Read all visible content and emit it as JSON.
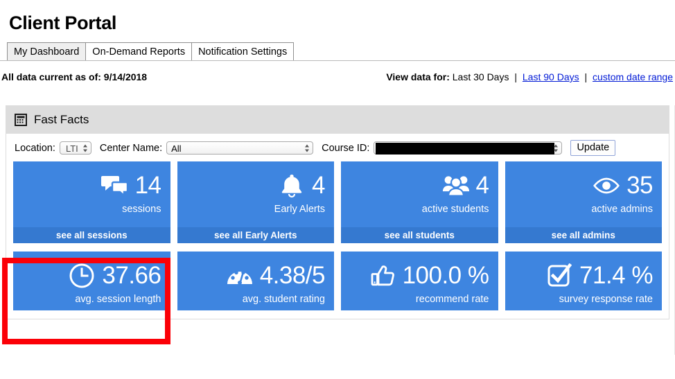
{
  "page": {
    "title": "Client Portal"
  },
  "tabs": [
    {
      "label": "My Dashboard",
      "active": true
    },
    {
      "label": "On-Demand Reports",
      "active": false
    },
    {
      "label": "Notification Settings",
      "active": false
    }
  ],
  "data_status": {
    "as_of_label": "All data current as of: 9/14/2018",
    "view_label": "View data for:",
    "current_range": "Last 30 Days",
    "separator": "|",
    "link_90": "Last 90 Days",
    "link_custom": "custom date range"
  },
  "panel": {
    "header_title": "Fast Facts",
    "header_icon": "calculator-icon",
    "filters": {
      "location_label": "Location:",
      "location_value": "LTI",
      "center_label": "Center Name:",
      "center_value": "All",
      "course_label": "Course ID:",
      "course_value": "",
      "update_label": "Update"
    }
  },
  "tiles_row1": [
    {
      "icon": "chat-bubbles-icon",
      "value": "14",
      "label": "sessions",
      "footer": "see all sessions"
    },
    {
      "icon": "bell-icon",
      "value": "4",
      "label": "Early Alerts",
      "footer": "see all Early Alerts"
    },
    {
      "icon": "people-group-icon",
      "value": "4",
      "label": "active students",
      "footer": "see all students"
    },
    {
      "icon": "eye-icon",
      "value": "35",
      "label": "active admins",
      "footer": "see all admins"
    }
  ],
  "tiles_row2": [
    {
      "icon": "clock-icon",
      "value": "37.66",
      "label": "avg. session length"
    },
    {
      "icon": "gauge-icon",
      "value": "4.38/5",
      "label": "avg. student rating"
    },
    {
      "icon": "thumbs-up-icon",
      "value": "100.0 %",
      "label": "recommend rate"
    },
    {
      "icon": "checkbox-checked-icon",
      "value": "71.4 %",
      "label": "survey response rate"
    }
  ],
  "annotation": {
    "highlight_color": "#fb0007",
    "highlight_target": "avg. session length"
  },
  "colors": {
    "tile_blue": "#3e85e0",
    "tile_footer_blue": "#3579d0",
    "panel_header_gray": "#dddddd",
    "link_blue": "#0019d6"
  }
}
